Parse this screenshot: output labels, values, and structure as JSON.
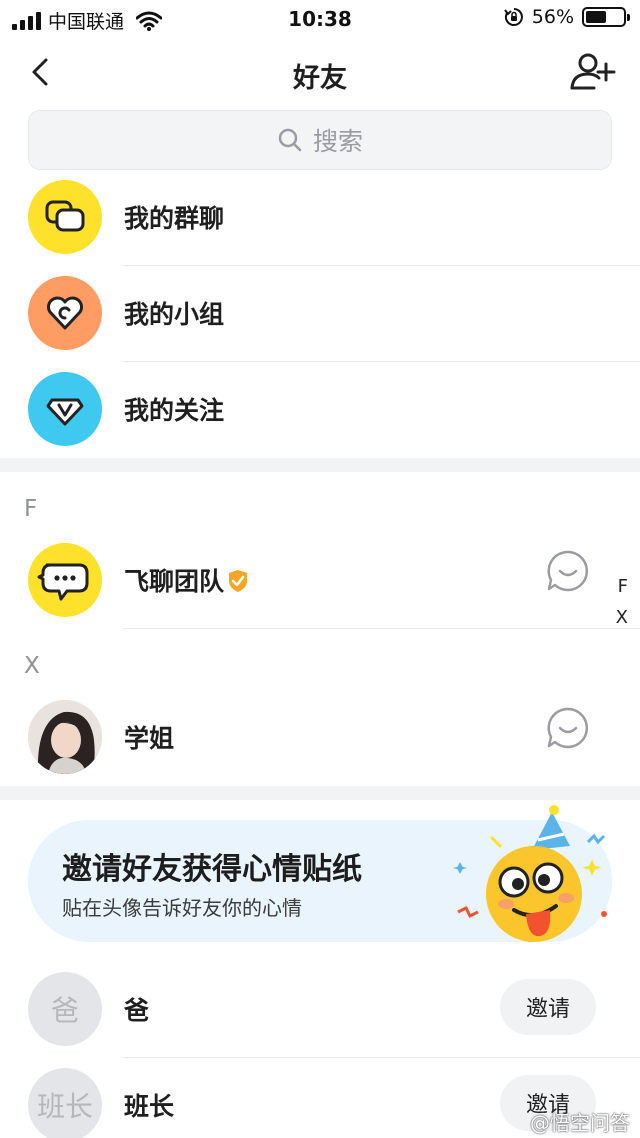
{
  "status_bar": {
    "carrier": "中国联通",
    "time": "10:38",
    "battery": "56%",
    "battery_level": 0.56
  },
  "nav": {
    "title": "好友"
  },
  "search": {
    "placeholder": "搜索"
  },
  "menu": [
    {
      "label": "我的群聊",
      "color": "#fde12b",
      "icon": "group-chat-icon"
    },
    {
      "label": "我的小组",
      "color": "#ff9c63",
      "icon": "heart-group-icon"
    },
    {
      "label": "我的关注",
      "color": "#3fc8f0",
      "icon": "follow-v-icon"
    }
  ],
  "sections": [
    {
      "letter": "F",
      "contacts": [
        {
          "name": "飞聊团队",
          "verified": true
        }
      ]
    },
    {
      "letter": "X",
      "contacts": [
        {
          "name": "学姐",
          "verified": false
        }
      ]
    }
  ],
  "index_bar": [
    "F",
    "X"
  ],
  "invite_banner": {
    "title": "邀请好友获得心情贴纸",
    "subtitle": "贴在头像告诉好友你的心情"
  },
  "invite_contacts": [
    {
      "avatar_text": "爸",
      "name": "爸",
      "button": "邀请"
    },
    {
      "avatar_text": "班长",
      "name": "班长",
      "button": "邀请"
    }
  ],
  "watermark": "@悟空问答",
  "colors": {
    "accent_yellow": "#fde12b",
    "verified_orange": "#f7a526",
    "banner_bg": "#e9f4fc"
  }
}
